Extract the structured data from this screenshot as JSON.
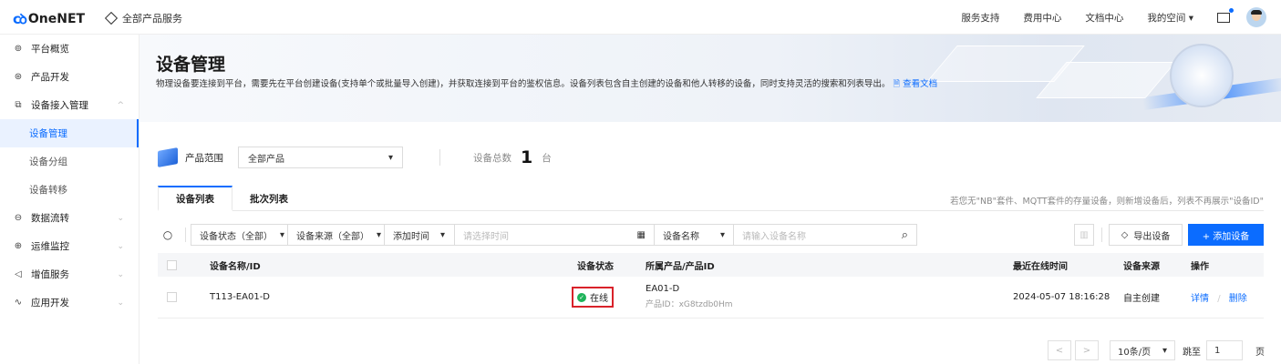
{
  "topbar": {
    "logo": "OneNET",
    "logo_mark": "cꝺ",
    "all_products": "全部产品服务",
    "nav": [
      "服务支持",
      "费用中心",
      "文档中心",
      "我的空间 ▾"
    ]
  },
  "sidebar": {
    "items": [
      {
        "label": "平台概览",
        "icon": "⊚"
      },
      {
        "label": "产品开发",
        "icon": "⊛"
      },
      {
        "label": "设备接入管理",
        "icon": "⧉",
        "expanded": "^"
      },
      {
        "label": "数据流转",
        "icon": "⊖",
        "chev": "⌄"
      },
      {
        "label": "运维监控",
        "icon": "⊕",
        "chev": "⌄"
      },
      {
        "label": "增值服务",
        "icon": "◁",
        "chev": "⌄"
      },
      {
        "label": "应用开发",
        "icon": "∿",
        "chev": "⌄"
      }
    ],
    "subitems": [
      "设备管理",
      "设备分组",
      "设备转移"
    ]
  },
  "banner": {
    "title": "设备管理",
    "desc": "物理设备要连接到平台，需要先在平台创建设备(支持单个或批量导入创建)，并获取连接到平台的鉴权信息。设备列表包含自主创建的设备和他人转移的设备，同时支持灵活的搜索和列表导出。",
    "doc_link": "🗎 查看文档"
  },
  "scope": {
    "label": "产品范围",
    "selected": "全部产品",
    "total_label": "设备总数",
    "total": "1",
    "unit": "台"
  },
  "tabs": {
    "items": [
      "设备列表",
      "批次列表"
    ],
    "hint": "若您无\"NB\"套件、MQTT套件的存量设备，则新增设备后，列表不再展示\"设备ID\""
  },
  "filters": {
    "status": "设备状态（全部）",
    "source": "设备来源（全部）",
    "time": "添加时间",
    "time_placeholder": "请选择时间",
    "name_field": "设备名称",
    "name_placeholder": "请输入设备名称",
    "export": "导出设备",
    "add": "+ 添加设备"
  },
  "table": {
    "headers": [
      "设备名称/ID",
      "设备状态",
      "所属产品/产品ID",
      "最近在线时间",
      "设备来源",
      "操作"
    ],
    "rows": [
      {
        "name": "T113-EA01-D",
        "status": "在线",
        "product": "EA01-D",
        "product_id": "产品ID：xG8tzdb0Hm",
        "last_online": "2024-05-07 18:16:28",
        "source": "自主创建",
        "detail": "详情",
        "sep": "/",
        "delete": "删除"
      }
    ]
  },
  "pager": {
    "prev": "<",
    "next": ">",
    "page_size": "10条/页",
    "goto": "跳至",
    "page": "1",
    "page_unit": "页"
  },
  "colors": {
    "accent": "#0b6cff",
    "online": "#1fb35a",
    "highlight": "#d9222a"
  }
}
